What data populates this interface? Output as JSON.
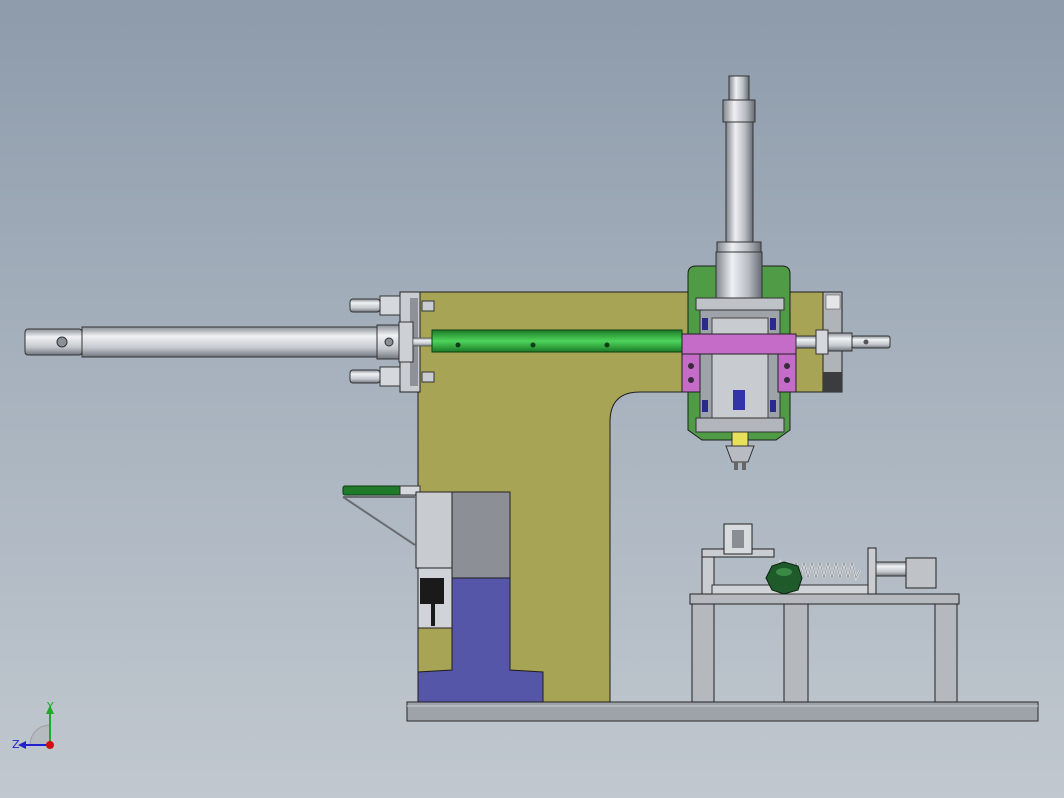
{
  "window": {
    "type": "cad-3d-viewport",
    "background_top": "#8d9bab",
    "background_bottom": "#c1c8cf"
  },
  "model": {
    "view": "front",
    "parts": [
      {
        "name": "base-plate",
        "color": "#9fa3aa"
      },
      {
        "name": "c-frame",
        "color": "#a8a455"
      },
      {
        "name": "horizontal-cylinder",
        "color": "#c8cdd3"
      },
      {
        "name": "guide-rail",
        "color": "#2ea83b"
      },
      {
        "name": "carriage-housing",
        "color": "#4f9b46"
      },
      {
        "name": "clamp-block",
        "color": "#c46cc8"
      },
      {
        "name": "vertical-cylinder",
        "color": "#b8bdc4"
      },
      {
        "name": "motor-base",
        "color": "#5556a8"
      },
      {
        "name": "gearbox",
        "color": "#8c8f96"
      },
      {
        "name": "fixture-table",
        "color": "#b5b8bd"
      },
      {
        "name": "spring",
        "color": "#d8dadc"
      },
      {
        "name": "green-roller",
        "color": "#1e5a2a"
      }
    ]
  },
  "triad": {
    "y_label": "Y",
    "z_label": "Z",
    "y_color": "#1faa2a",
    "z_color": "#2222cc",
    "x_color": "#d01010"
  }
}
